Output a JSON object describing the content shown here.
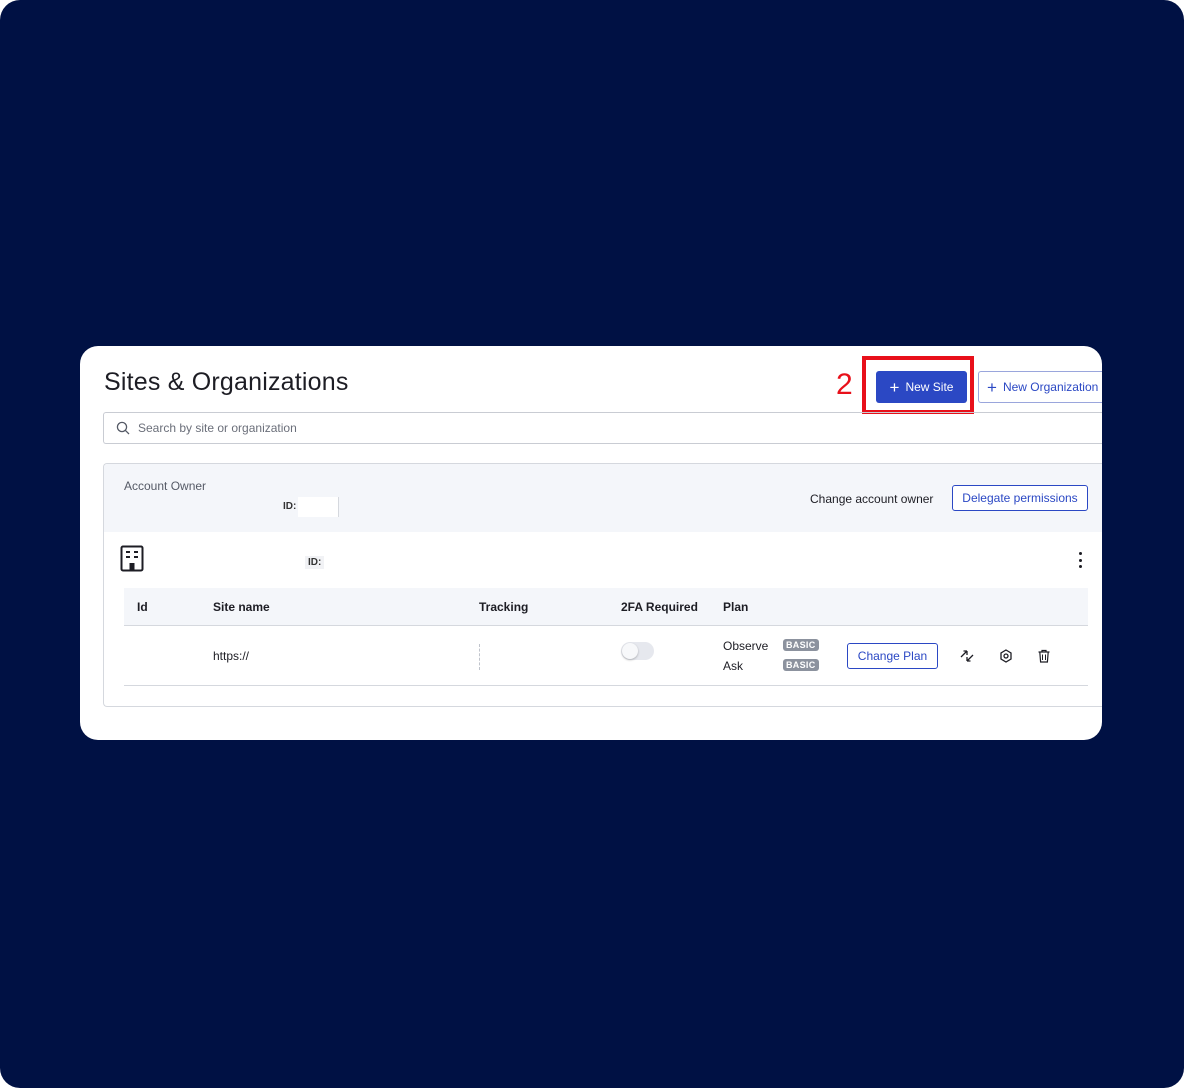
{
  "page": {
    "title": "Sites & Organizations"
  },
  "annotation": {
    "step": "2",
    "highlight_color": "#e8101a"
  },
  "toolbar": {
    "new_site_label": "New Site",
    "new_org_label": "New Organization",
    "accent_color": "#2b48c4"
  },
  "search": {
    "placeholder": "Search by site or organization",
    "value": ""
  },
  "account": {
    "owner_label": "Account Owner",
    "id_label": "ID:",
    "change_owner_label": "Change account owner",
    "delegate_label": "Delegate permissions"
  },
  "organization": {
    "icon": "building-icon",
    "id_label": "ID:",
    "menu_icon": "kebab-menu-icon"
  },
  "table": {
    "columns": [
      "Id",
      "Site name",
      "Tracking",
      "2FA Required",
      "Plan"
    ],
    "rows": [
      {
        "id": "",
        "site_name": "https://",
        "tracking": "",
        "two_fa_required": false,
        "plans": [
          {
            "name": "Observe",
            "tier": "BASIC"
          },
          {
            "name": "Ask",
            "tier": "BASIC"
          }
        ],
        "change_plan_label": "Change Plan",
        "action_icons": [
          "transfer-icon",
          "settings-icon",
          "trash-icon"
        ]
      }
    ]
  }
}
